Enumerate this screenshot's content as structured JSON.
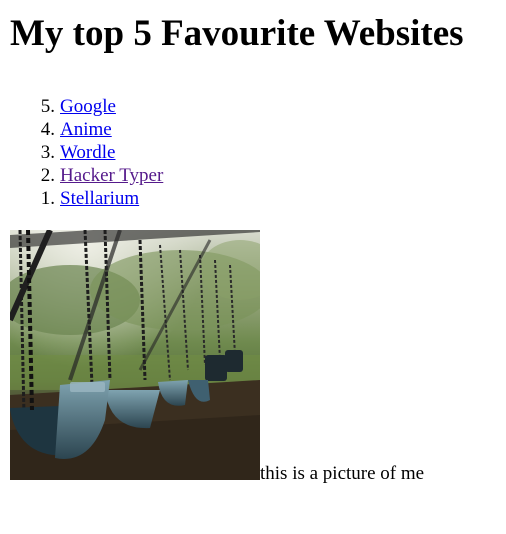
{
  "page": {
    "title": "My top 5 Favourite Websites"
  },
  "list": {
    "items": [
      {
        "number": "5.",
        "label": "Google",
        "visited": false
      },
      {
        "number": "4.",
        "label": "Anime",
        "visited": false
      },
      {
        "number": "3.",
        "label": "Wordle",
        "visited": false
      },
      {
        "number": "2.",
        "label": "Hacker Typer",
        "visited": true
      },
      {
        "number": "1.",
        "label": "Stellarium",
        "visited": false
      }
    ]
  },
  "photo": {
    "caption": "this is a picture of me"
  },
  "colors": {
    "link": "#0000ee",
    "visited_link": "#551a8b"
  }
}
